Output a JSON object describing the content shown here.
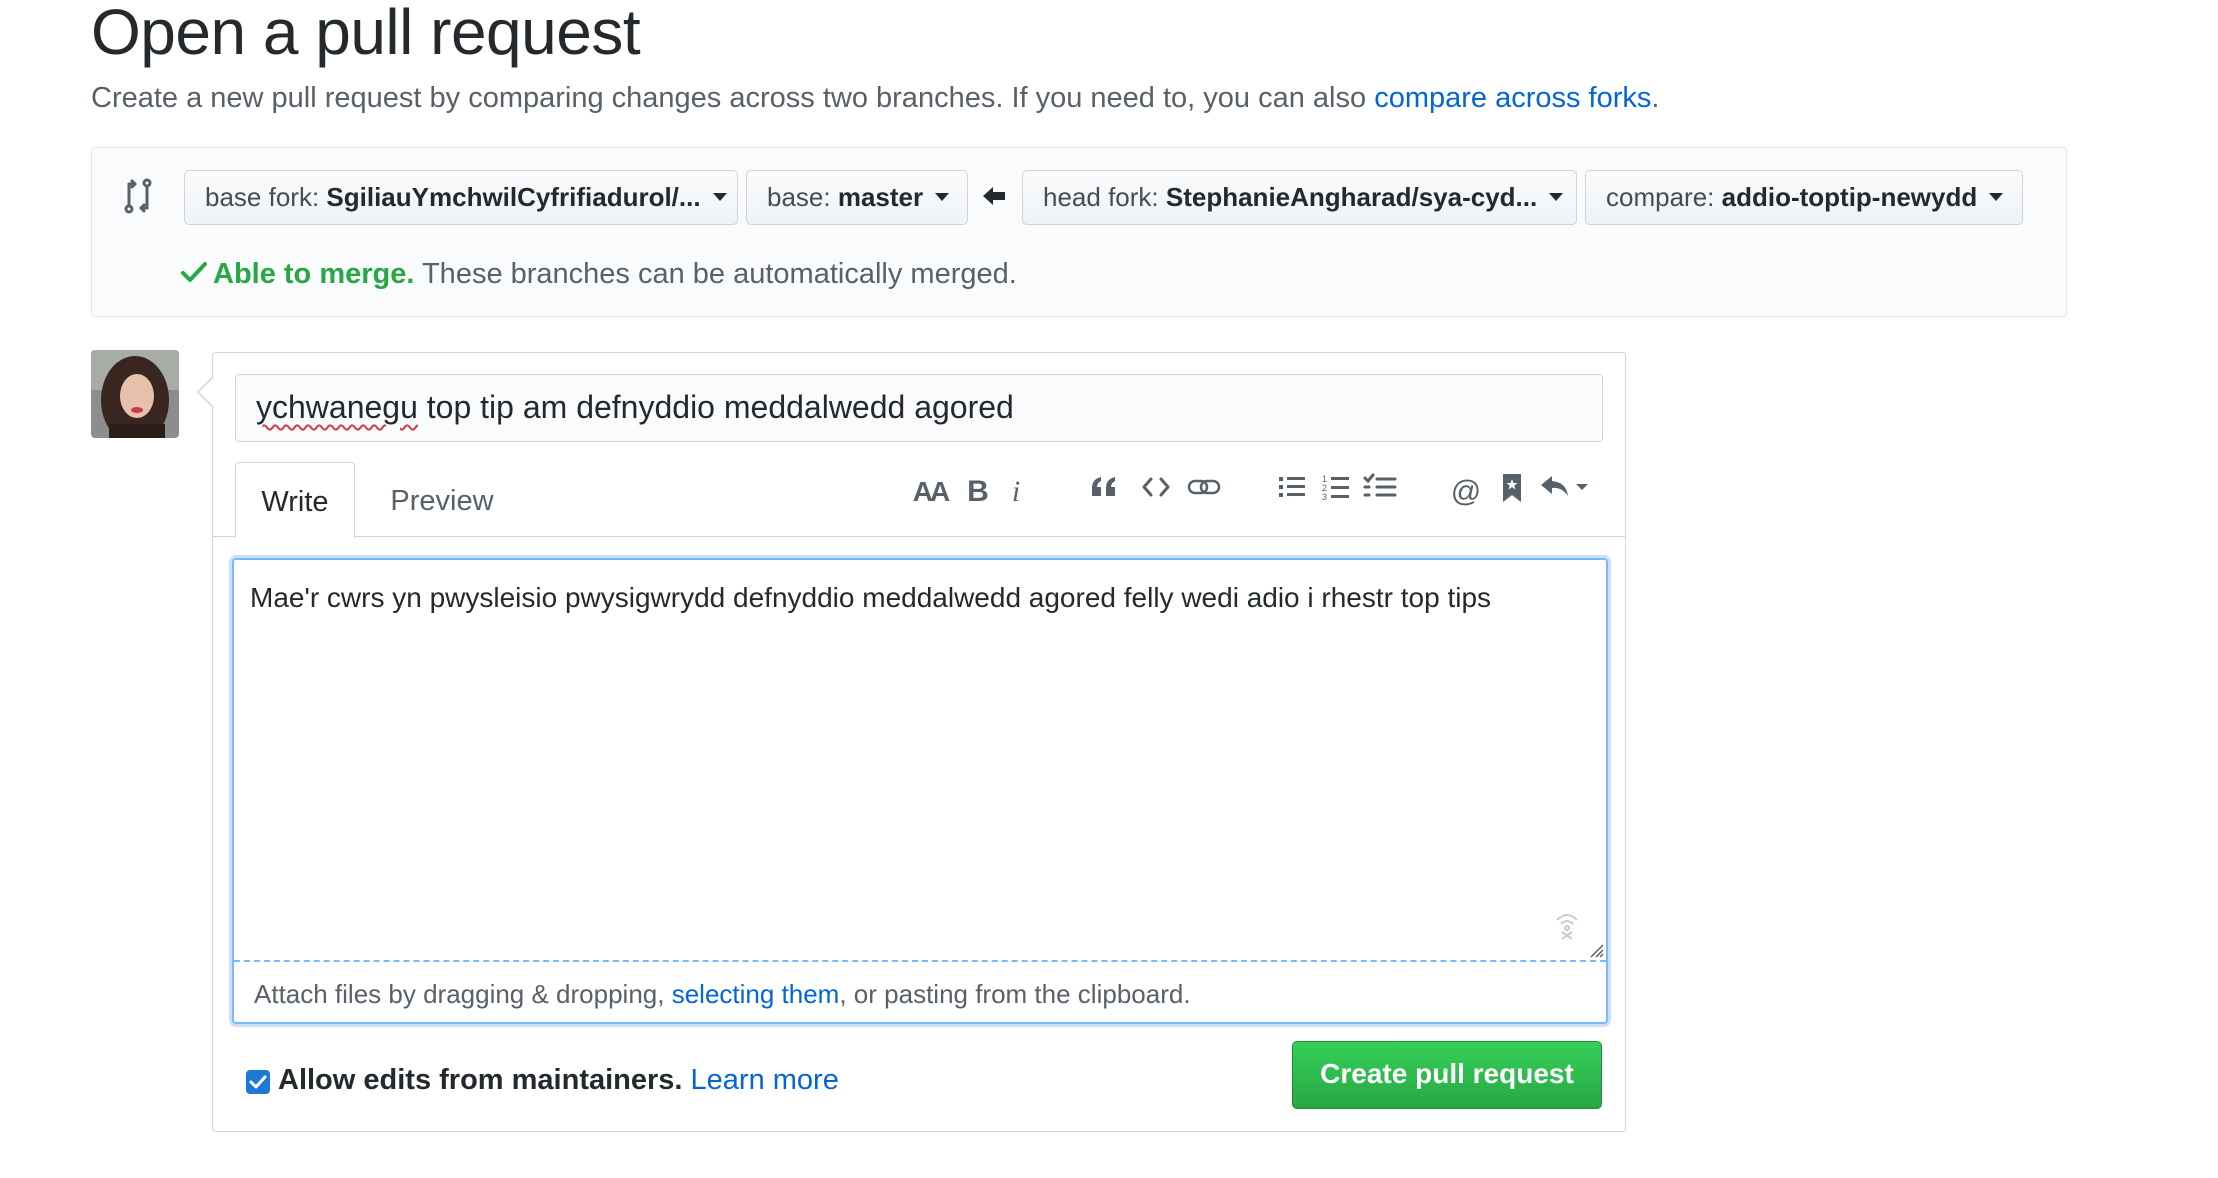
{
  "page": {
    "title": "Open a pull request",
    "subtitle_prefix": "Create a new pull request by comparing changes across two branches. If you need to, you can also ",
    "subtitle_link": "compare across forks",
    "subtitle_suffix": "."
  },
  "range": {
    "base_fork": {
      "label": "base fork:",
      "value": "SgiliauYmchwilCyfrifiadurol/..."
    },
    "base": {
      "label": "base:",
      "value": "master"
    },
    "head_fork": {
      "label": "head fork:",
      "value": "StephanieAngharad/sya-cyd..."
    },
    "compare": {
      "label": "compare:",
      "value": "addio-toptip-newydd"
    },
    "merge_status_ok": "Able to merge.",
    "merge_status_rest": " These branches can be automatically merged."
  },
  "form": {
    "title_spell": "ychwanegu",
    "title_rest": " top tip am defnyddio meddalwedd agored",
    "tabs": {
      "write": "Write",
      "preview": "Preview"
    },
    "toolbar_icons": [
      "text-size-icon",
      "bold-icon",
      "italic-icon",
      "quote-icon",
      "code-icon",
      "link-icon",
      "bullet-list-icon",
      "numbered-list-icon",
      "task-list-icon",
      "mention-icon",
      "bookmark-icon",
      "reply-icon"
    ],
    "toolbar_glyphs": {
      "text_size": "AA",
      "bold": "B",
      "italic": "i",
      "mention": "@"
    },
    "body": "Mae'r cwrs yn pwysleisio pwysigwrydd defnyddio meddalwedd agored felly wedi adio i rhestr top tips",
    "attach_prefix": "Attach files by dragging & dropping, ",
    "attach_link": "selecting them",
    "attach_suffix": ", or pasting from the clipboard.",
    "allow_edits_label": "Allow edits from maintainers.",
    "allow_edits_checked": true,
    "learn_more": "Learn more",
    "submit_label": "Create pull request"
  },
  "colors": {
    "accent_link": "#0366d6",
    "success_green": "#28a745",
    "focus_blue": "#79b8ff"
  }
}
